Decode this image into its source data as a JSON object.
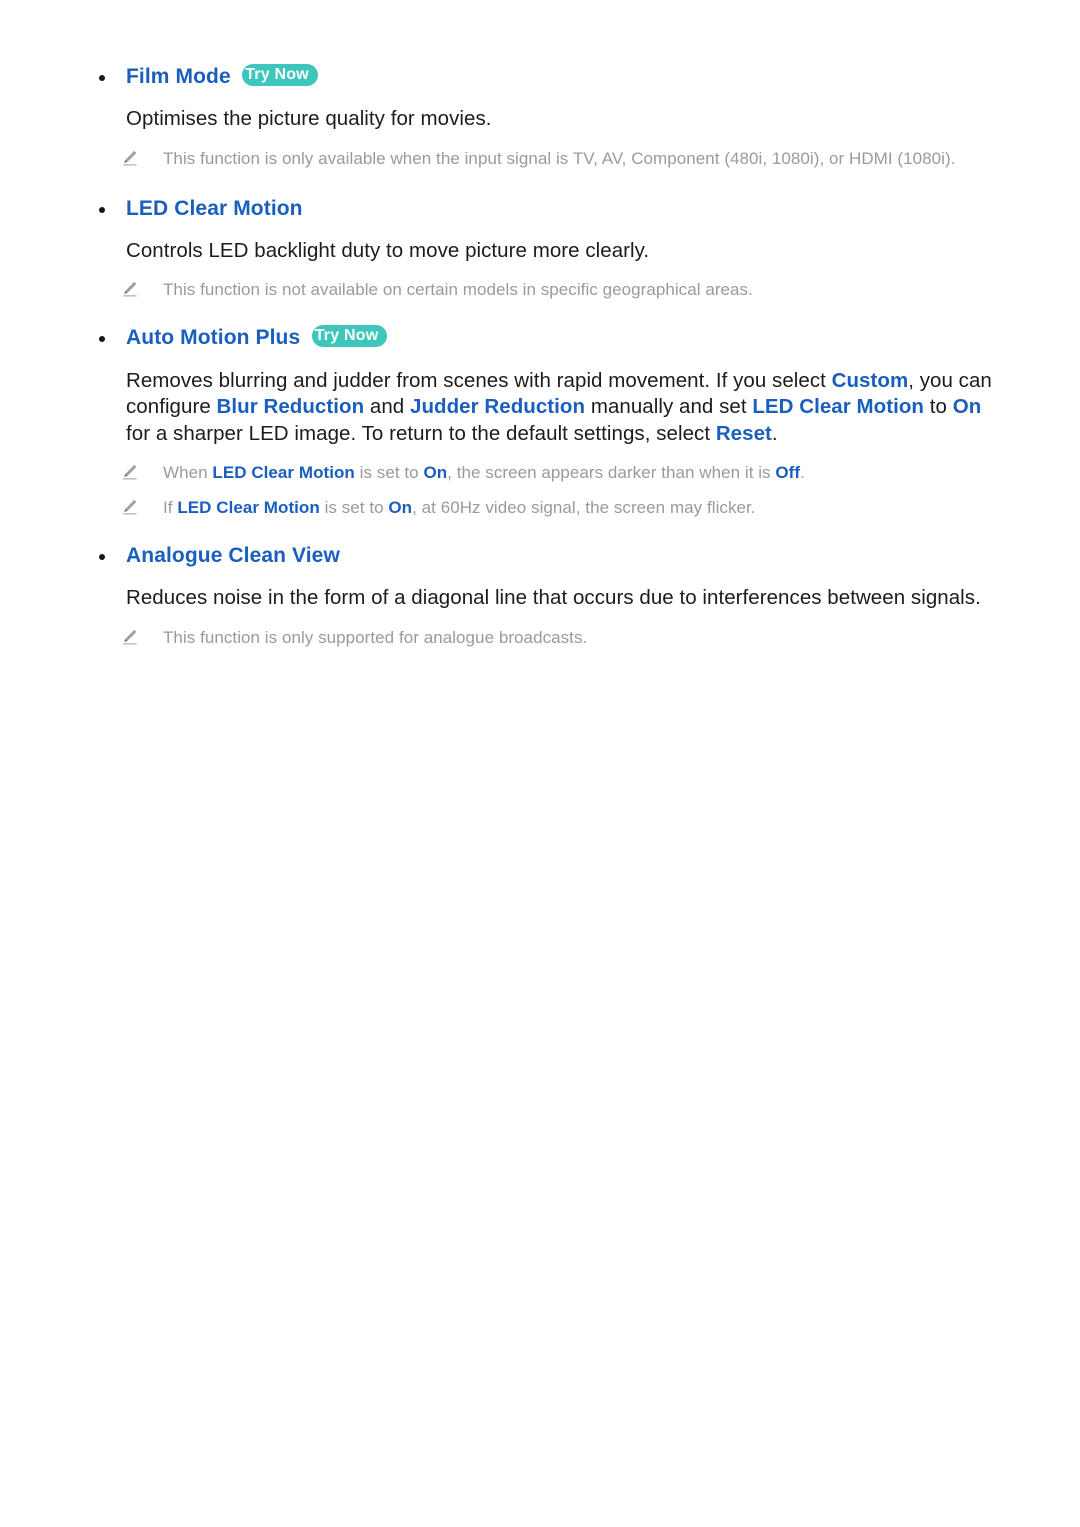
{
  "document": {
    "page_background": "#ffffff",
    "heading_color": "#1a5fbe",
    "body_color": "#1c1c1c",
    "note_color": "#9a9a9a",
    "badge_color": "#3ec6bd",
    "badge_text_color": "#ffffff"
  },
  "sections": [
    {
      "id": "film-mode",
      "heading": "Film Mode",
      "badge": "Try Now",
      "body": "Optimises the picture quality for movies.",
      "notes": [
        "This function is only available when the input signal is TV, AV, Component (480i, 1080i), or HDMI (1080i)."
      ]
    },
    {
      "id": "led-clear-motion",
      "heading": "LED Clear Motion",
      "badge": null,
      "body": "Controls LED backlight duty to move picture more clearly.",
      "notes": [
        "This function is not available on certain models in specific geographical areas."
      ]
    },
    {
      "id": "auto-motion-plus",
      "heading": "Auto Motion Plus",
      "badge": "Try Now",
      "body_parts": {
        "p1": "Removes blurring and judder from scenes with rapid movement. If you select ",
        "t1": "Custom",
        "p2": ", you can configure ",
        "t2": "Blur Reduction",
        "p3": " and ",
        "t3": "Judder Reduction",
        "p4": " manually and set ",
        "t4": "LED Clear Motion",
        "p5": " to ",
        "t5": "On",
        "p6": " for a sharper LED image. To return to the default settings, select ",
        "t6": "Reset",
        "p7": "."
      },
      "note_parts_1": {
        "p1": "When ",
        "t1": "LED Clear Motion",
        "p2": " is set to ",
        "t2": "On",
        "p3": ", the screen appears darker than when it is ",
        "t3": "Off",
        "p4": "."
      },
      "note_parts_2": {
        "p1": "If ",
        "t1": "LED Clear Motion",
        "p2": " is set to ",
        "t2": "On",
        "p3": ", at 60Hz video signal, the screen may flicker."
      }
    },
    {
      "id": "analogue-clean-view",
      "heading": "Analogue Clean View",
      "badge": null,
      "body": "Reduces noise in the form of a diagonal line that occurs due to interferences between signals.",
      "notes": [
        "This function is only supported for analogue broadcasts."
      ]
    }
  ],
  "icons": {
    "note_icon": "pencil-icon",
    "bullet": "bullet-dot"
  }
}
